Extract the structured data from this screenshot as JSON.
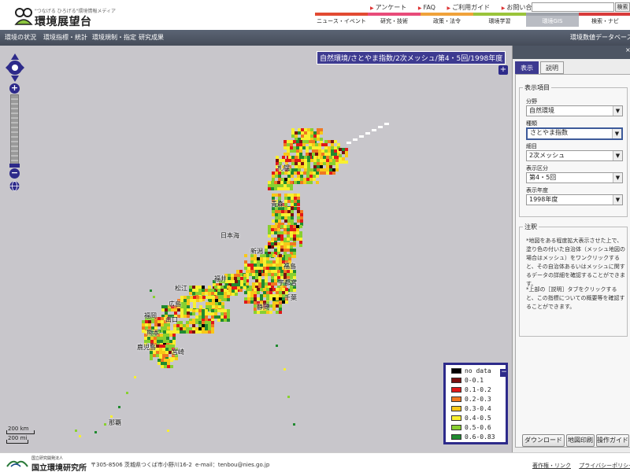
{
  "header": {
    "tagline": "\"つなげる ひろげる\"環境情報メディア",
    "site_title": "環境展望台",
    "top_links": [
      "アンケート",
      "FAQ",
      "ご利用ガイド",
      "お問い合わせ"
    ],
    "search_button": "検索",
    "nav_tabs": [
      {
        "label": "ニュース・イベント",
        "color": "#e24a32"
      },
      {
        "label": "研究・技術",
        "color": "#e84b7a"
      },
      {
        "label": "政策・法令",
        "color": "#f0a23a"
      },
      {
        "label": "環境学習",
        "color": "#9ac43a"
      },
      {
        "label": "環境GIS",
        "color": "#9fa3ab"
      },
      {
        "label": "検索・ナビ",
        "color": "#d83b3b"
      }
    ]
  },
  "subnav": {
    "items": [
      "環境の状況",
      "環境指標・統計",
      "環境規制・指定",
      "研究成果"
    ],
    "right_title": "環境数値データベース"
  },
  "map": {
    "title": "自然環境/さとやま指数/2次メッシュ/第4・5回/1998年度",
    "expand_label": "+",
    "zoom_in": "+",
    "zoom_out": "−",
    "scale": {
      "top": "200 km",
      "bottom": "200 mi"
    },
    "places": [
      {
        "label": "札幌"
      },
      {
        "label": "青森"
      },
      {
        "label": "日本海"
      },
      {
        "label": "新潟"
      },
      {
        "label": "福島"
      },
      {
        "label": "宇都宮"
      },
      {
        "label": "千葉"
      },
      {
        "label": "静岡"
      },
      {
        "label": "福井"
      },
      {
        "label": "松江"
      },
      {
        "label": "広島"
      },
      {
        "label": "山口"
      },
      {
        "label": "福岡"
      },
      {
        "label": "熊本"
      },
      {
        "label": "鹿児島"
      },
      {
        "label": "宮崎"
      },
      {
        "label": "那覇"
      }
    ]
  },
  "legend": {
    "toggle": "−",
    "items": [
      {
        "label": "no data",
        "color": "#000000"
      },
      {
        "label": "0-0.1",
        "color": "#7a1010"
      },
      {
        "label": "0.1-0.2",
        "color": "#e01818"
      },
      {
        "label": "0.2-0.3",
        "color": "#f07820"
      },
      {
        "label": "0.3-0.4",
        "color": "#f8c818"
      },
      {
        "label": "0.4-0.5",
        "color": "#f8f030"
      },
      {
        "label": "0.5-0.6",
        "color": "#88d030"
      },
      {
        "label": "0.6-0.83",
        "color": "#208a30"
      }
    ]
  },
  "panel": {
    "close": "×",
    "tabs": [
      "表示",
      "説明"
    ],
    "display_section": "表示項目",
    "fields": [
      {
        "label": "分野",
        "value": "自然環境"
      },
      {
        "label": "種類",
        "value": "さとやま指数"
      },
      {
        "label": "細目",
        "value": "2次メッシュ"
      },
      {
        "label": "表示区分",
        "value": "第4・5回"
      },
      {
        "label": "表示年度",
        "value": "1998年度"
      }
    ],
    "notes_section": "注釈",
    "notes": [
      "*地図をある程度拡大表示させた上で、塗り色の付いた自治体（メッシュ地図の場合はメッシュ）をワンクリックすると、その自治体あるいはメッシュに関するデータの詳細を確認することができます。",
      "*上部の［説明］タブをクリックすると、この指標についての概要等を確認することができます。"
    ],
    "buttons": [
      "ダウンロード",
      "地図印刷",
      "操作ガイド"
    ]
  },
  "footer": {
    "org_small": "国立研究開発法人",
    "org": "国立環境研究所",
    "address": "〒305-8506 茨城県つくば市小野川16-2",
    "email": "e-mail：tenbou@nies.go.jp",
    "links": [
      "著作権・リンク",
      "プライバシーポリシー"
    ]
  }
}
